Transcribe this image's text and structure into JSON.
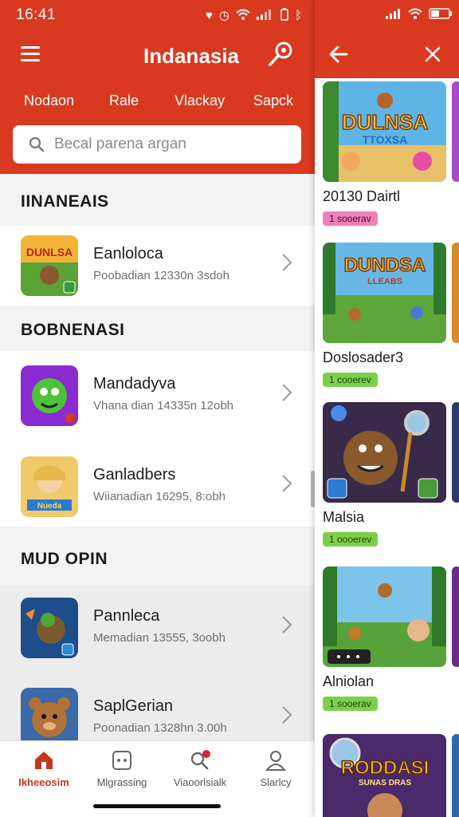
{
  "status": {
    "time": "16:41"
  },
  "header": {
    "title": "Indanasia",
    "tabs": [
      "Nodaon",
      "Rale",
      "Vlackay",
      "Sapck"
    ]
  },
  "search": {
    "placeholder": "Becal parena argan"
  },
  "sections": [
    {
      "heading": "IINANEAIS",
      "items": [
        {
          "title": "Eanloloca",
          "sub": "Poobadian 12330n 3sdoh"
        }
      ]
    },
    {
      "heading": "BOBNENASI",
      "items": [
        {
          "title": "Mandadyva",
          "sub": "Vhana dian 14335n 12obh"
        },
        {
          "title": "Ganladbers",
          "sub": "Wiianadian 16295, 8:obh"
        }
      ]
    },
    {
      "heading": "MUD OPIN",
      "items": [
        {
          "title": "Pannleca",
          "sub": "Memadian 13555, 3oobh"
        },
        {
          "title": "SaplGerian",
          "sub": "Poonadian 1328hn 3.00h"
        }
      ]
    }
  ],
  "bottom_nav": [
    {
      "label": "Ikheeosim",
      "icon": "home-icon",
      "active": true
    },
    {
      "label": "Mlgrassing",
      "icon": "grid-icon",
      "active": false
    },
    {
      "label": "Viaoorlsialk",
      "icon": "search-notification-icon",
      "active": false
    },
    {
      "label": "Slarlcy",
      "icon": "person-icon",
      "active": false
    }
  ],
  "right_panel": {
    "cards": [
      {
        "title": "20130 Dairtl",
        "badge": "1 sooerav",
        "badge_color": "pink",
        "art_text": "DULNSA",
        "art_subtext": "TTOXSA"
      },
      {
        "title": "Doslosader3",
        "badge": "1 cooerev",
        "badge_color": "green",
        "art_text": "DUNDSA",
        "art_subtext": "LLEABS"
      },
      {
        "title": "Malsia",
        "badge": "1 oooerev",
        "badge_color": "green",
        "art_text": "",
        "art_subtext": ""
      },
      {
        "title": "Alniolan",
        "badge": "1 sooerav",
        "badge_color": "green",
        "art_text": "",
        "art_subtext": ""
      },
      {
        "title": "",
        "badge": "",
        "badge_color": "green",
        "art_text": "RODDASI",
        "art_subtext": "SUNAS DRAS"
      }
    ]
  },
  "colors": {
    "brand": "#d8391f",
    "badge_green": "#7bd04a",
    "badge_pink": "#f080b8"
  }
}
